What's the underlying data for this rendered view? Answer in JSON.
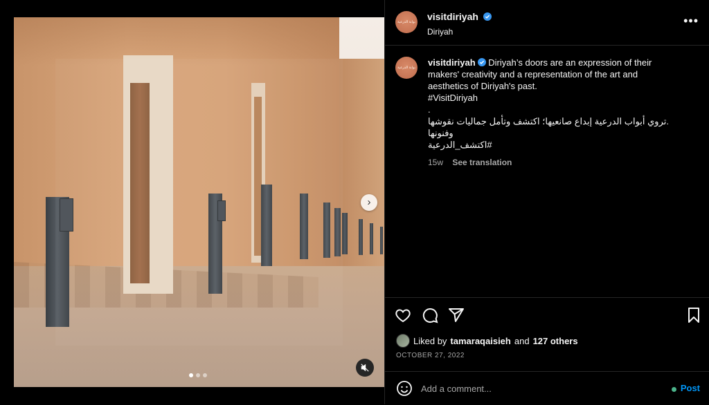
{
  "post": {
    "username": "visitdiriyah",
    "location": "Diriyah",
    "avatar_text": "بوابة الدرعية",
    "caption_lines": [
      "Diriyah’s doors are an expression of their makers' creativity and a representation of the art and aesthetics of Diriyah's past.",
      "#VisitDiriyah",
      ".",
      ".تروي أبواب الدرعية إبداع صانعيها؛ اكتشف وتأمل جماليات نقوشها وفنونها",
      "#اكتشف_الدرعية"
    ],
    "age": "15w",
    "see_translation": "See translation",
    "likes": {
      "prefix": "Liked by",
      "user": "tamaraqaisieh",
      "middle": "and",
      "others": "127 others"
    },
    "date": "OCTOBER 27, 2022"
  },
  "media": {
    "slide_count": 3,
    "active_slide": 1
  },
  "comment": {
    "placeholder": "Add a comment...",
    "post_label": "Post"
  },
  "icons": {
    "more": "more-icon",
    "like": "heart-icon",
    "comment": "comment-icon",
    "share": "send-icon",
    "save": "bookmark-icon",
    "emoji": "emoji-icon",
    "mute": "muted-icon",
    "next": "chevron-right-icon",
    "verified": "verified-badge-icon"
  },
  "colors": {
    "accent": "#0095f6",
    "verified": "#3897f0",
    "text": "#f5f5f5",
    "muted": "#a8a8a8"
  }
}
